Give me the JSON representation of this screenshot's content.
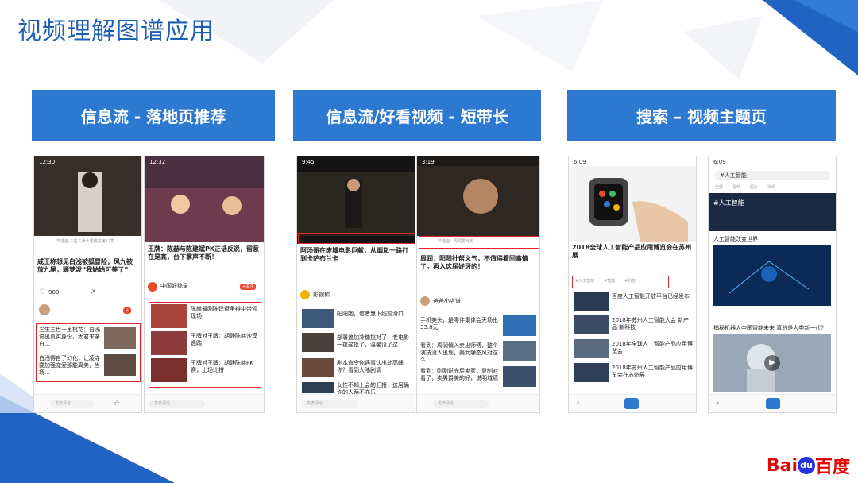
{
  "slide": {
    "title": "视频理解图谱应用"
  },
  "columns": [
    {
      "header": "信息流 - 落地页推荐"
    },
    {
      "header": "信息流/好看视频 - 短带长"
    },
    {
      "header": "搜索 – 视频主题页"
    }
  ],
  "colors": {
    "header_bg": "#2d79d2",
    "title": "#1c5fb3",
    "highlight_border": "#e0262a",
    "baidu_blue": "#2932e1",
    "baidu_red": "#e10601"
  },
  "brand": {
    "part1": "Bai",
    "part2": "du",
    "part3": "百度",
    "icon": "paw-icon"
  },
  "phones": {
    "p1": {
      "time": "12:30",
      "l1": "节选自-三生三世十里桃花第12集",
      "headline": "咸王称想见白浅被狐冒险，凤九被放九尾，颍梦泼“我姑姑可美了”",
      "stat": "900",
      "item1": "三生三世十里桃花：白浅说出真实身份，太君求亲白…",
      "item2": "白浅得自了幻化，让凌寺要加强宠爱那能离美，当场…",
      "input": "发表评论..."
    },
    "p2": {
      "time": "12:32",
      "headline": "王牌：陈赫与陈建斌PK正话反说，留意在是高，台下掌声不断！",
      "source": "中国好综录",
      "follow": "+关注",
      "rel1": "陈赫最刚陈建斌争辩中带领现场",
      "rel2": "王牌对王牌：胡静陈赫沙漠逃踏",
      "rel3": "王牌对王牌：胡静陈赫PK赛，上场比拼",
      "input": "发表评论..."
    },
    "p3": {
      "time": "9:45",
      "headline": "阿汤哥在废墟电影巨献，从烟岚一路打到卡萨布兰卡",
      "author": "影视和",
      "rel1": "阳阳她，信者慧下线前滑口",
      "rel2": "部署追加冷糖挑对了，老电影一夜这批了，温馨请了这",
      "rel3": "剧本命令你遇事认出劫高峰你？看到大陆剧调",
      "rel4": "女性不知上会的汇报，这层确你的人两不亦乐",
      "input": "发表评论..."
    },
    "p4": {
      "time": "3:19",
      "l1": "节选自：周润发光影",
      "headline": "周润：阳阳社帮义气，不值得看回事情了。再入这届好牙的！",
      "author": "爸爸小店谱",
      "rel1": "手机美头，是零件集体会天场出33.8元",
      "rel2": "看到：周润俏入卖出师傅，整个演技没人出现，美女静态风对这么",
      "rel3": "看到：刚刚说完后卖家，复制对看了，卖男爵美的好，说明城墙",
      "input": "发表评论..."
    },
    "p5": {
      "time": "6:09",
      "headline": "2018全球人工智能产品应用博览会在苏州展",
      "tab1": "#人工智能",
      "tab2": "#智能",
      "tab3": "#科技",
      "rel1": "百度人工智能开放平台已经发布",
      "rel2": "2018年苏州人工智能大会 新产品 新科技",
      "rel3": "2018年全球人工智能产品应用博览会",
      "rel4": "2018年苏州人工智能产品应用博览会在苏州展"
    },
    "p6": {
      "time": "6:09",
      "search": "#人工智能",
      "tab_a": "全部",
      "tab_b": "视频",
      "tab_c": "图片",
      "tab_d": "资讯",
      "hero": "#人工智能",
      "s1": "人工智能改变世界",
      "s2": "揭秘机器人中国智能未来 真的是人类新一代？"
    }
  }
}
